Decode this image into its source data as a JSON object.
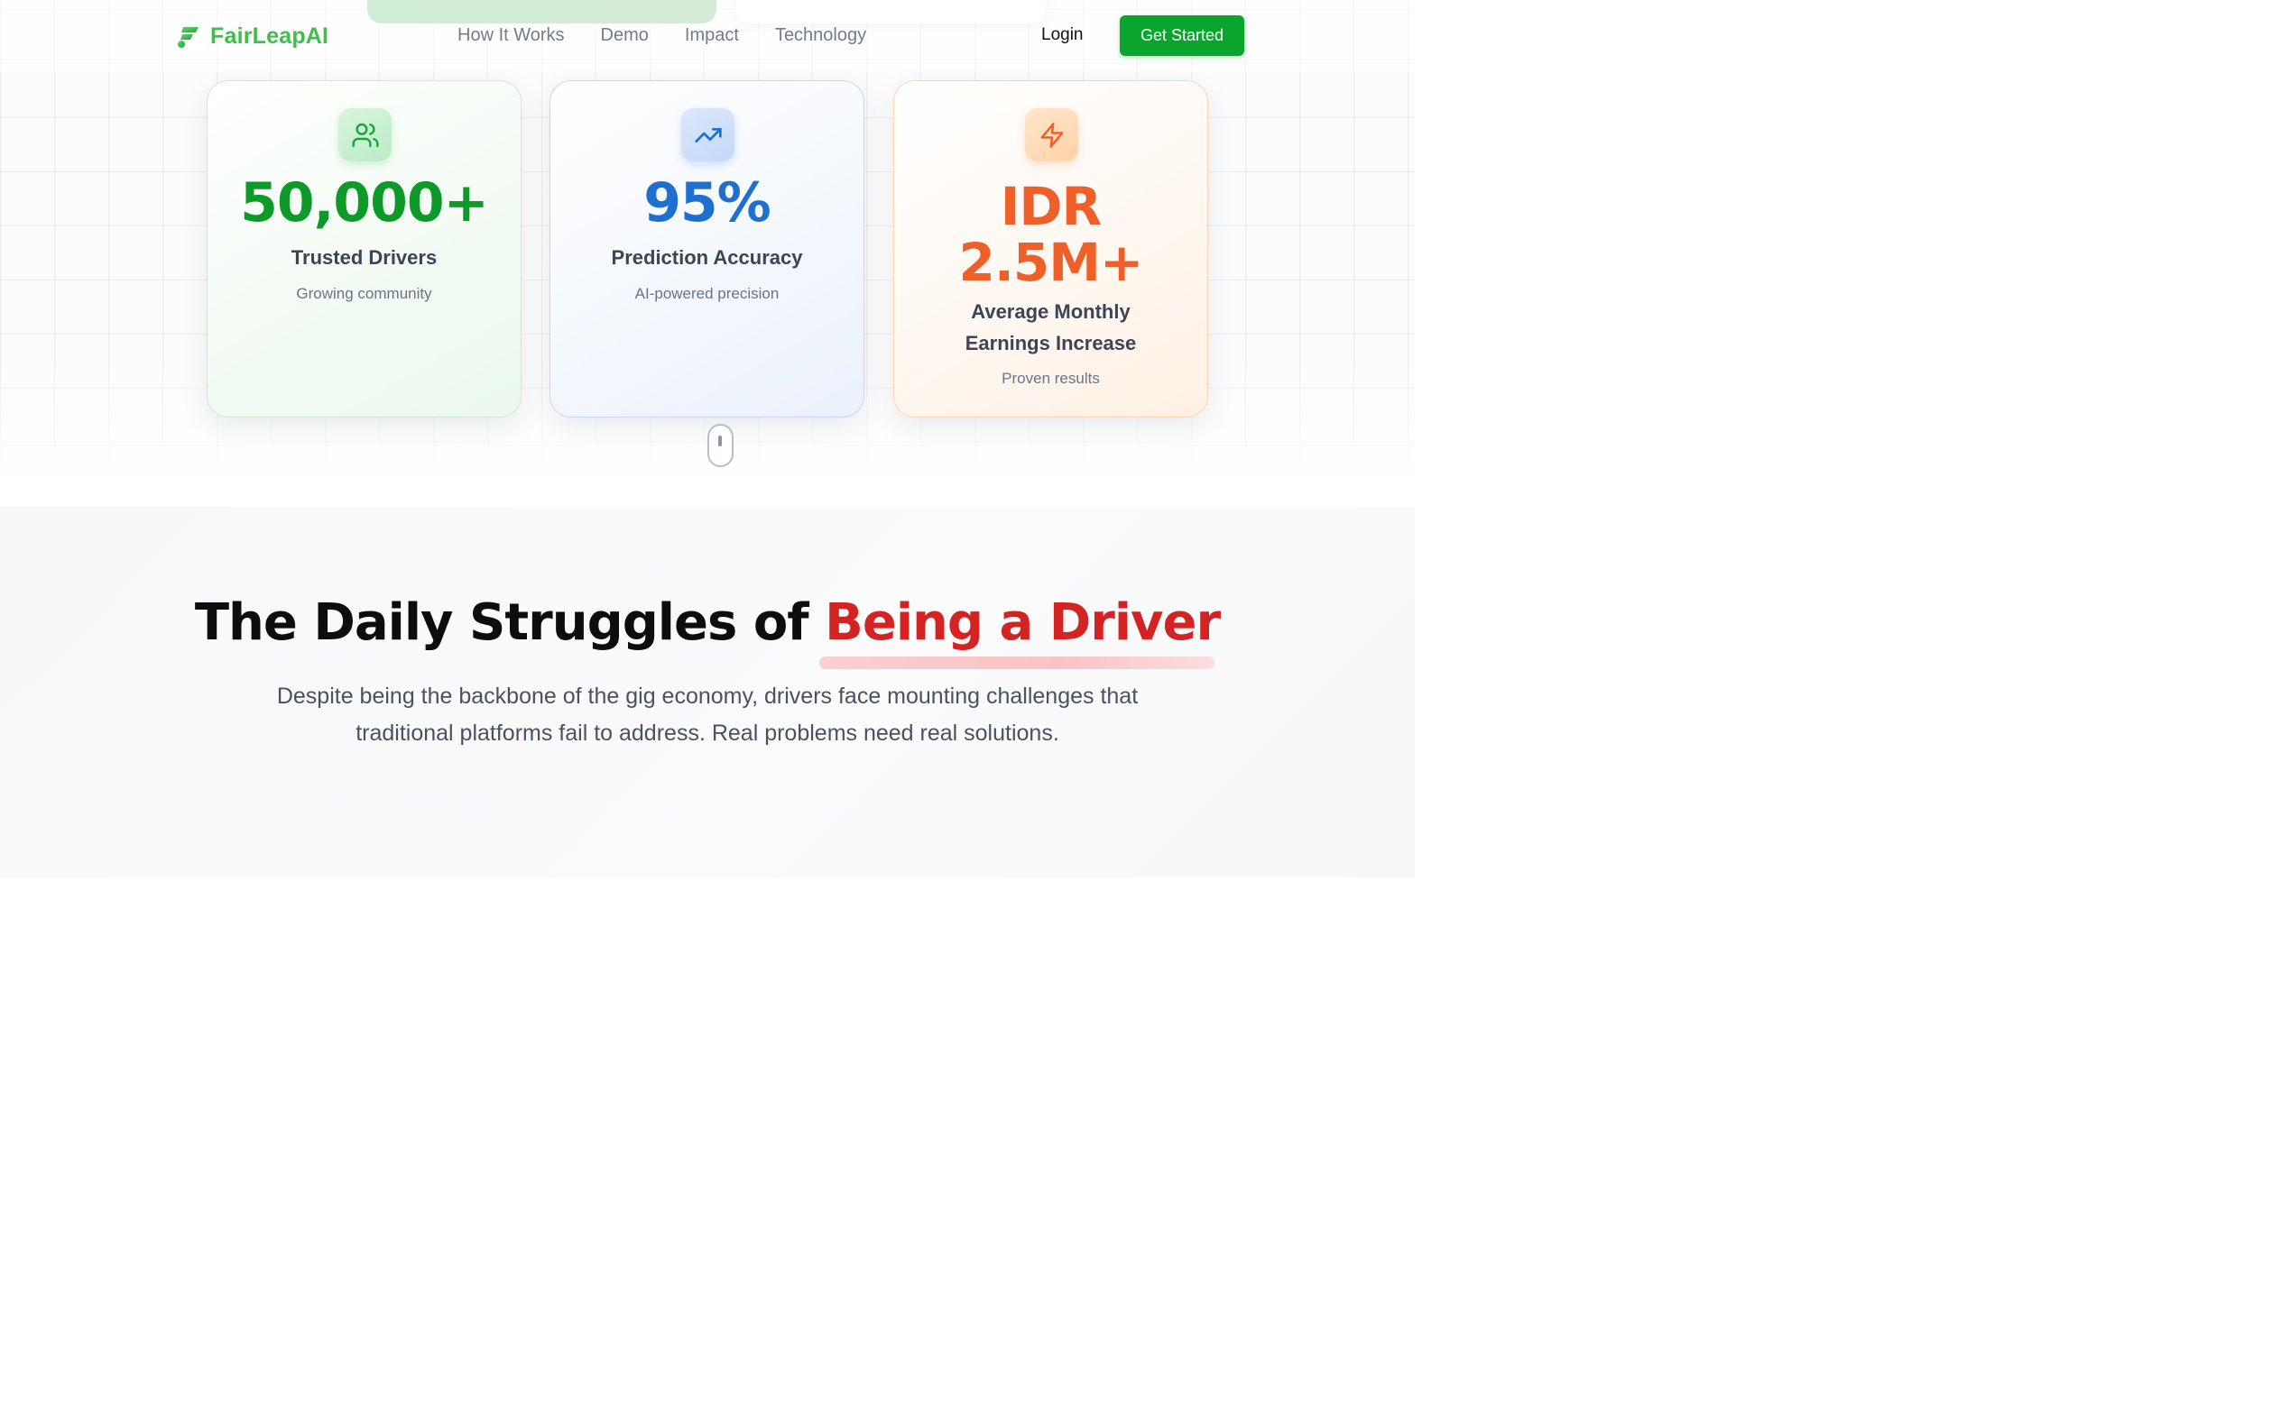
{
  "brand": {
    "name": "FairLeapAI",
    "logo_icon": "leaf-steps-icon",
    "color": "#3fbf4a"
  },
  "nav": {
    "links": [
      "How It Works",
      "Demo",
      "Impact",
      "Technology"
    ],
    "login": "Login",
    "cta": "Get Started",
    "cta_color": "#0aa52d"
  },
  "stats": [
    {
      "icon": "users-icon",
      "value": "50,000+",
      "label": "Trusted Drivers",
      "sub": "Growing community",
      "color": "#0d9a28"
    },
    {
      "icon": "trending-up-icon",
      "value": "95%",
      "label": "Prediction Accuracy",
      "sub": "AI-powered precision",
      "color": "#1e6fd0"
    },
    {
      "icon": "lightning-bolt-icon",
      "value_line1": "IDR",
      "value_line2": "2.5M+",
      "label": "Average Monthly Earnings Increase",
      "sub": "Proven results",
      "color": "#ef5f2a"
    }
  ],
  "scroll_indicator": "mouse-scroll-icon",
  "struggles": {
    "heading_main": "The Daily Struggles of",
    "heading_accent": "Being a Driver",
    "accent_color": "#d42323",
    "description": "Despite being the backbone of the gig economy, drivers face mounting challenges that traditional platforms fail to address. Real problems need real solutions."
  }
}
